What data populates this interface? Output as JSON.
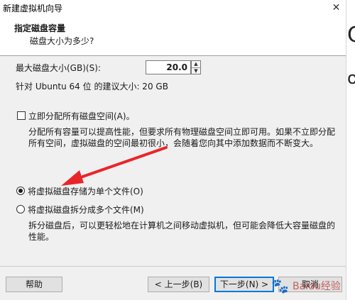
{
  "window": {
    "title": "新建虚拟机向导",
    "close_glyph": "✕"
  },
  "header": {
    "title": "指定磁盘容量",
    "subtitle": "磁盘大小为多少?"
  },
  "max_disk": {
    "label": "最大磁盘大小(GB)(S):",
    "value": "20.0",
    "recommend": "针对 Ubuntu 64 位 的建议大小: 20 GB"
  },
  "allocate": {
    "label": "立即分配所有磁盘空间(A)。",
    "checked": false,
    "desc_line1": "分配所有容量可以提高性能，但要求所有物理磁盘空间立即可用。如果不立即分配",
    "desc_line2": "所有空间，虚拟磁盘的空间最初很小，会随着您向其中添加数据而不断变大。"
  },
  "storage_options": [
    {
      "label": "将虚拟磁盘存储为单个文件(O)",
      "selected": true
    },
    {
      "label": "将虚拟磁盘拆分成多个文件(M)",
      "selected": false
    }
  ],
  "split_desc_line1": "拆分磁盘后，可以更轻松地在计算机之间移动虚拟机，但可能会降低大容量磁盘的",
  "split_desc_line2": "性能。",
  "buttons": {
    "help": "帮助",
    "back": "< 上一步(B)",
    "next": "下一步(N) >",
    "cancel": "取消"
  },
  "annotation_arrow_color": "#e8262a",
  "background_fragments": [
    "C",
    "o"
  ],
  "watermark": {
    "text": "Baidu经验"
  }
}
